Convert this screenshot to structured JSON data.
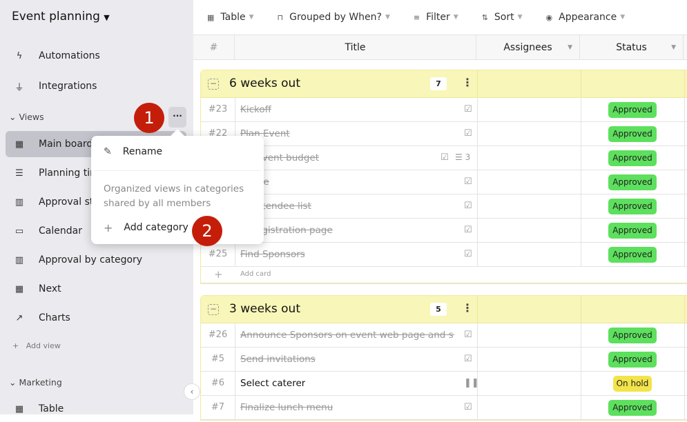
{
  "sidebar": {
    "title": "Event planning",
    "items_top": [
      {
        "label": "Automations",
        "icon": "bolt-icon"
      },
      {
        "label": "Integrations",
        "icon": "plug-icon"
      }
    ],
    "views_label": "Views",
    "views": [
      {
        "label": "Main board",
        "icon": "table-icon"
      },
      {
        "label": "Planning tim",
        "icon": "timeline-icon"
      },
      {
        "label": "Approval sta",
        "icon": "board-icon"
      },
      {
        "label": "Calendar",
        "icon": "calendar-icon"
      },
      {
        "label": "Approval by category",
        "icon": "board-icon"
      },
      {
        "label": "Next",
        "icon": "table-icon"
      },
      {
        "label": "Charts",
        "icon": "chart-icon"
      }
    ],
    "add_view": "Add view",
    "marketing_label": "Marketing",
    "marketing_views": [
      {
        "label": "Table",
        "icon": "table-icon"
      }
    ]
  },
  "toolbar": {
    "items": [
      {
        "label": "Table",
        "icon": "table-icon"
      },
      {
        "label": "Grouped by When?",
        "icon": "group-icon"
      },
      {
        "label": "Filter",
        "icon": "filter-icon"
      },
      {
        "label": "Sort",
        "icon": "sort-icon"
      },
      {
        "label": "Appearance",
        "icon": "eye-icon"
      }
    ]
  },
  "columns": [
    "#",
    "Title",
    "Assignees",
    "Status"
  ],
  "status_colors": {
    "Approved": "#5de05d",
    "On hold": "#f2e44a"
  },
  "groups": [
    {
      "title": "6 weeks out",
      "count": "7",
      "rows": [
        {
          "num": "#23",
          "title": "Kickoff",
          "done": true,
          "status": "Approved"
        },
        {
          "num": "#22",
          "title": "Plan Event",
          "done": true,
          "status": "Approved"
        },
        {
          "num": "",
          "title": "ize event budget",
          "done": true,
          "status": "Approved",
          "subtasks": "3"
        },
        {
          "num": "",
          "title": "venue",
          "done": true,
          "status": "Approved"
        },
        {
          "num": "",
          "title": "re attendee list",
          "done": true,
          "status": "Approved"
        },
        {
          "num": "",
          "title": "re registration page",
          "done": true,
          "status": "Approved"
        },
        {
          "num": "#25",
          "title": "Find Sponsors",
          "done": true,
          "status": "Approved"
        }
      ],
      "add_card": "Add card"
    },
    {
      "title": "3 weeks out",
      "count": "5",
      "rows": [
        {
          "num": "#26",
          "title": "Announce Sponsors on event web page and s...",
          "done": true,
          "status": "Approved"
        },
        {
          "num": "#5",
          "title": "Send invitations",
          "done": true,
          "status": "Approved"
        },
        {
          "num": "#6",
          "title": "Select caterer",
          "done": false,
          "status": "On hold"
        },
        {
          "num": "#7",
          "title": "Finalize lunch menu",
          "done": true,
          "status": "Approved"
        }
      ]
    }
  ],
  "popup": {
    "rename": "Rename",
    "description": "Organized views in categories shared by all members",
    "add_category": "Add category"
  },
  "steps": [
    "1",
    "2"
  ]
}
